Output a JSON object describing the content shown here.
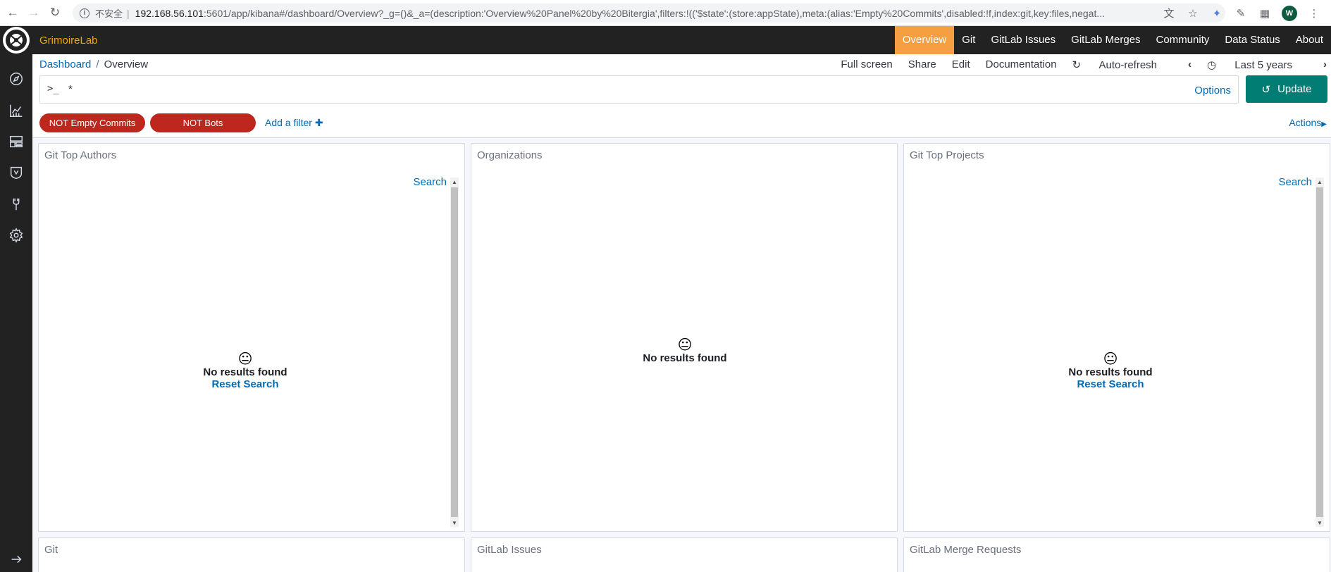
{
  "browser": {
    "insecure_label": "不安全",
    "url_host": "192.168.56.101",
    "url_rest": ":5601/app/kibana#/dashboard/Overview?_g=()&_a=(description:'Overview%20Panel%20by%20Bitergia',filters:!(('$state':(store:appState),meta:(alias:'Empty%20Commits',disabled:!f,index:git,key:files,negat...",
    "avatar_letter": "W"
  },
  "header": {
    "brand": "GrimoireLab",
    "menu": [
      "Overview",
      "Git",
      "GitLab Issues",
      "GitLab Merges",
      "Community",
      "Data Status",
      "About"
    ],
    "active_color": "#f59e42"
  },
  "breadcrumb": {
    "root": "Dashboard",
    "current": "Overview"
  },
  "toolbar": {
    "full_screen": "Full screen",
    "share": "Share",
    "edit": "Edit",
    "documentation": "Documentation",
    "auto_refresh": "Auto-refresh",
    "time_range": "Last 5 years"
  },
  "query": {
    "prompt": ">_",
    "value": "*",
    "options_label": "Options",
    "update_label": "Update"
  },
  "filters": {
    "pills": [
      "NOT Empty Commits",
      "NOT Bots"
    ],
    "add_filter": "Add a filter",
    "actions": "Actions",
    "pill_color": "#bd271e"
  },
  "panels": {
    "top_authors": {
      "title": "Git Top Authors",
      "search": "Search",
      "no_results": "No results found",
      "reset": "Reset Search"
    },
    "organizations": {
      "title": "Organizations",
      "no_results": "No results found"
    },
    "top_projects": {
      "title": "Git Top Projects",
      "search": "Search",
      "no_results": "No results found",
      "reset": "Reset Search"
    },
    "git": {
      "title": "Git"
    },
    "gitlab_issues": {
      "title": "GitLab Issues"
    },
    "gitlab_merge_requests": {
      "title": "GitLab Merge Requests"
    }
  },
  "icons": {
    "back": "arrow-left-icon",
    "forward": "arrow-right-icon",
    "reload": "reload-icon",
    "discover": "compass-icon",
    "visualize": "chart-icon",
    "dashboard": "dashboard-icon",
    "timelion": "shield-icon",
    "devtools": "wrench-icon",
    "management": "gear-icon",
    "collapse": "expand-arrow-icon"
  }
}
